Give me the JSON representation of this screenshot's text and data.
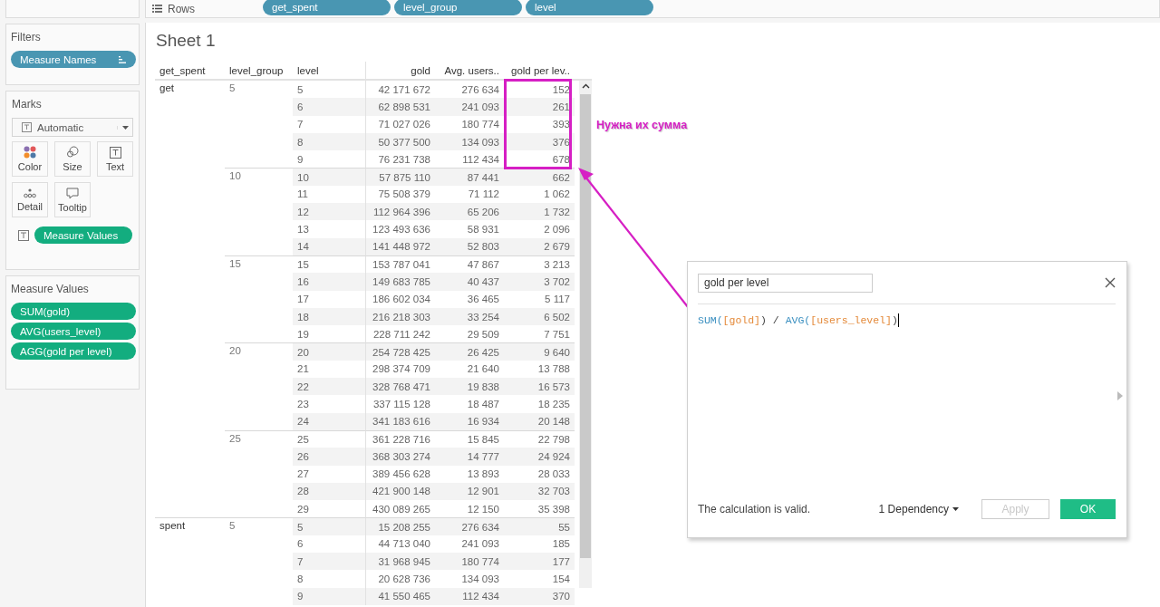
{
  "shelf": {
    "label": "Rows",
    "pills": [
      "get_spent",
      "level_group",
      "level"
    ]
  },
  "filters": {
    "title": "Filters",
    "pills": [
      "Measure Names"
    ]
  },
  "marks": {
    "title": "Marks",
    "mark_type": "Automatic",
    "buttons": [
      {
        "label": "Color",
        "kind": "color"
      },
      {
        "label": "Size",
        "kind": "size"
      },
      {
        "label": "Text",
        "kind": "text"
      },
      {
        "label": "Detail",
        "kind": "detail"
      },
      {
        "label": "Tooltip",
        "kind": "tooltip"
      }
    ],
    "pills": [
      "Measure Values"
    ]
  },
  "measure_values": {
    "title": "Measure Values",
    "pills": [
      "SUM(gold)",
      "AVG(users_level)",
      "AGG(gold per level)"
    ]
  },
  "sheet": {
    "title": "Sheet 1",
    "columns": [
      "get_spent",
      "level_group",
      "level",
      "gold",
      "Avg. users..",
      "gold per lev.."
    ],
    "groups": [
      {
        "label": "get",
        "children": [
          {
            "label": "5",
            "rows": [
              {
                "level": "5",
                "gold": "42 171 672",
                "avg": "276 634",
                "gpl": "152",
                "highlighted": true
              },
              {
                "level": "6",
                "gold": "62 898 531",
                "avg": "241 093",
                "gpl": "261",
                "highlighted": true
              },
              {
                "level": "7",
                "gold": "71 027 026",
                "avg": "180 774",
                "gpl": "393",
                "highlighted": true
              },
              {
                "level": "8",
                "gold": "50 377 500",
                "avg": "134 093",
                "gpl": "376",
                "highlighted": true
              },
              {
                "level": "9",
                "gold": "76 231 738",
                "avg": "112 434",
                "gpl": "678",
                "highlighted": true
              }
            ]
          },
          {
            "label": "10",
            "rows": [
              {
                "level": "10",
                "gold": "57 875 110",
                "avg": "87 441",
                "gpl": "662",
                "highlighted": false
              },
              {
                "level": "11",
                "gold": "75 508 379",
                "avg": "71 112",
                "gpl": "1 062",
                "highlighted": false
              },
              {
                "level": "12",
                "gold": "112 964 396",
                "avg": "65 206",
                "gpl": "1 732",
                "highlighted": false
              },
              {
                "level": "13",
                "gold": "123 493 636",
                "avg": "58 931",
                "gpl": "2 096",
                "highlighted": false
              },
              {
                "level": "14",
                "gold": "141 448 972",
                "avg": "52 803",
                "gpl": "2 679",
                "highlighted": false
              }
            ]
          },
          {
            "label": "15",
            "rows": [
              {
                "level": "15",
                "gold": "153 787 041",
                "avg": "47 867",
                "gpl": "3 213",
                "highlighted": false
              },
              {
                "level": "16",
                "gold": "149 683 785",
                "avg": "40 437",
                "gpl": "3 702",
                "highlighted": false
              },
              {
                "level": "17",
                "gold": "186 602 034",
                "avg": "36 465",
                "gpl": "5 117",
                "highlighted": false
              },
              {
                "level": "18",
                "gold": "216 218 303",
                "avg": "33 254",
                "gpl": "6 502",
                "highlighted": false
              },
              {
                "level": "19",
                "gold": "228 711 242",
                "avg": "29 509",
                "gpl": "7 751",
                "highlighted": false
              }
            ]
          },
          {
            "label": "20",
            "rows": [
              {
                "level": "20",
                "gold": "254 728 425",
                "avg": "26 425",
                "gpl": "9 640",
                "highlighted": false
              },
              {
                "level": "21",
                "gold": "298 374 709",
                "avg": "21 640",
                "gpl": "13 788",
                "highlighted": false
              },
              {
                "level": "22",
                "gold": "328 768 471",
                "avg": "19 838",
                "gpl": "16 573",
                "highlighted": false
              },
              {
                "level": "23",
                "gold": "337 115 128",
                "avg": "18 487",
                "gpl": "18 235",
                "highlighted": false
              },
              {
                "level": "24",
                "gold": "341 183 616",
                "avg": "16 934",
                "gpl": "20 148",
                "highlighted": false
              }
            ]
          },
          {
            "label": "25",
            "rows": [
              {
                "level": "25",
                "gold": "361 228 716",
                "avg": "15 845",
                "gpl": "22 798",
                "highlighted": false
              },
              {
                "level": "26",
                "gold": "368 303 274",
                "avg": "14 777",
                "gpl": "24 924",
                "highlighted": false
              },
              {
                "level": "27",
                "gold": "389 456 628",
                "avg": "13 893",
                "gpl": "28 033",
                "highlighted": false
              },
              {
                "level": "28",
                "gold": "421 900 148",
                "avg": "12 901",
                "gpl": "32 703",
                "highlighted": false
              },
              {
                "level": "29",
                "gold": "430 089 265",
                "avg": "12 150",
                "gpl": "35 398",
                "highlighted": false
              }
            ]
          }
        ]
      },
      {
        "label": "spent",
        "children": [
          {
            "label": "5",
            "rows": [
              {
                "level": "5",
                "gold": "15 208 255",
                "avg": "276 634",
                "gpl": "55",
                "highlighted": false
              },
              {
                "level": "6",
                "gold": "44 713 040",
                "avg": "241 093",
                "gpl": "185",
                "highlighted": false
              },
              {
                "level": "7",
                "gold": "31 968 945",
                "avg": "180 774",
                "gpl": "177",
                "highlighted": false
              },
              {
                "level": "8",
                "gold": "20 628 736",
                "avg": "134 093",
                "gpl": "154",
                "highlighted": false
              },
              {
                "level": "9",
                "gold": "41 550 465",
                "avg": "112 434",
                "gpl": "370",
                "highlighted": false
              }
            ]
          }
        ]
      }
    ]
  },
  "annotation": {
    "note": "Нужна их сумма"
  },
  "calc_dialog": {
    "name": "gold per level",
    "formula": [
      {
        "text": "SUM(",
        "kind": "function"
      },
      {
        "text": "[gold]",
        "kind": "field"
      },
      {
        "text": ") / ",
        "kind": "operator"
      },
      {
        "text": "AVG(",
        "kind": "function"
      },
      {
        "text": "[users_level]",
        "kind": "field"
      },
      {
        "text": ")",
        "kind": "operator"
      }
    ],
    "status": "The calculation is valid.",
    "dependency": "1 Dependency",
    "buttons": [
      {
        "label": "Apply",
        "disabled": true,
        "primary": false
      },
      {
        "label": "OK",
        "disabled": false,
        "primary": true
      }
    ]
  }
}
